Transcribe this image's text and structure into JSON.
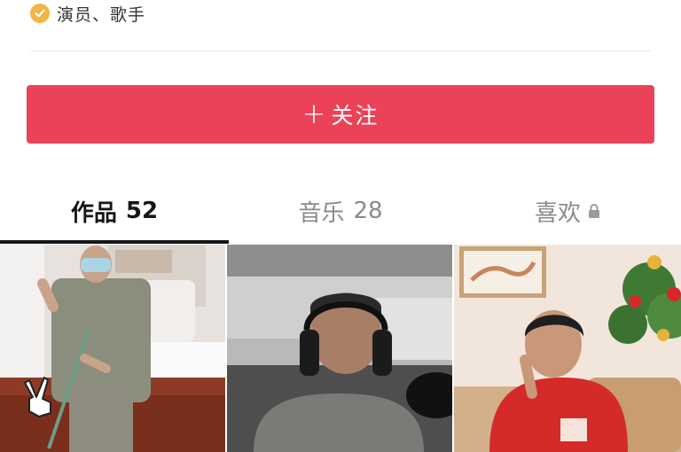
{
  "profile": {
    "verified_text": "演员、歌手",
    "verified_icon": "check-badge-icon"
  },
  "follow_button": {
    "plus": "+",
    "label": "关注",
    "color": "#eb4259"
  },
  "tabs": [
    {
      "name": "作品",
      "count": "52",
      "active": true
    },
    {
      "name": "音乐",
      "count": "28",
      "active": false
    },
    {
      "name": "喜欢",
      "icon": "lock-icon",
      "active": false
    }
  ],
  "videos": [
    {
      "thumbnail": "man-in-mask-sweeping-floor",
      "icon": "peace-sign-hand-icon"
    },
    {
      "thumbnail": "man-with-headphones-at-microphone"
    },
    {
      "thumbnail": "man-in-red-sweater-festive-room"
    }
  ]
}
